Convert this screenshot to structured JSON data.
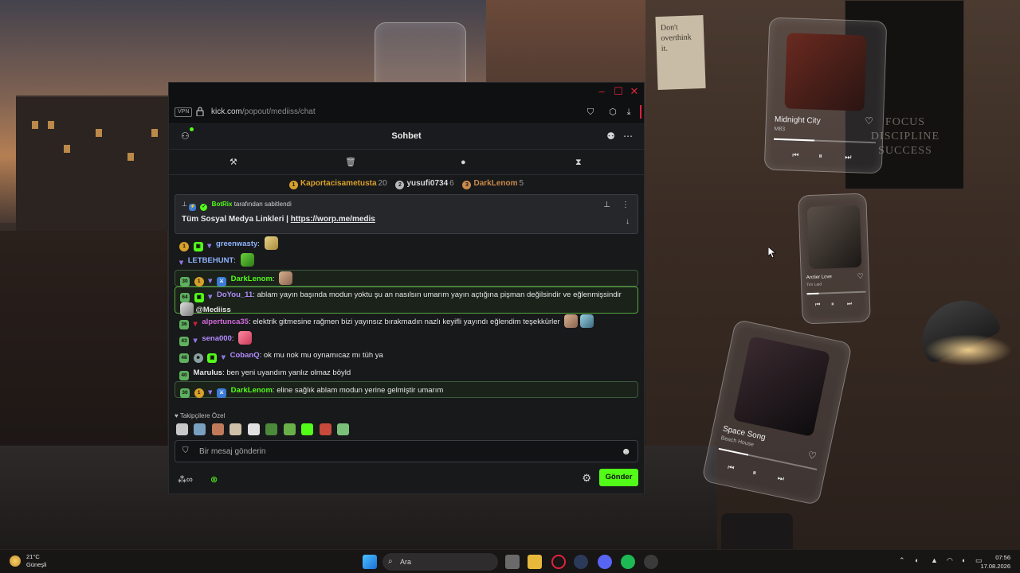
{
  "browser": {
    "vpn_label": "VPN",
    "url_host": "kick.com",
    "url_path": "/popout/mediiss/chat"
  },
  "chat": {
    "title": "Sohbet",
    "top_gifters": [
      {
        "rank": "1",
        "name": "Kaportacisametusta",
        "count": "20",
        "color": "#d8a12a"
      },
      {
        "rank": "2",
        "name": "yusufi0734",
        "count": "6",
        "color": "#b9b9b9"
      },
      {
        "rank": "3",
        "name": "DarkLenom",
        "count": "5",
        "color": "#c98a4a"
      }
    ],
    "pinned": {
      "author": "BotRix",
      "suffix": "tarafından sabitlendi",
      "text": "Tüm Sosyal Medya Linkleri | ",
      "link": "https://worp.me/medis"
    },
    "messages": [
      {
        "badge": "1",
        "user": "greenwasty",
        "color": "#8fb4ff",
        "text": ""
      },
      {
        "badge": "",
        "user": "LETBEHUNT",
        "color": "#8fb4ff",
        "text": ""
      },
      {
        "badge": "30",
        "user": "DarkLenom",
        "color": "#53fc18",
        "text": ""
      },
      {
        "badge": "64",
        "user": "DoYou_11",
        "color": "#b38cff",
        "text": "ablam yayın başında modun yoktu şu an nasılsın umarım yayın açtığına pişman değilsindir ve eğlenmişsindir",
        "text2": "@Mediiss"
      },
      {
        "badge": "36",
        "user": "alpertunca35",
        "color": "#d36bdc",
        "text": "elektrik gitmesine rağmen bizi yayınsız bırakmadın nazlı keyifli yayındı eğlendim teşekkürler"
      },
      {
        "badge": "43",
        "user": "sena000",
        "color": "#b38cff",
        "text": ""
      },
      {
        "badge": "48",
        "user": "CobanQ",
        "color": "#b38cff",
        "text": "ok mu nok mu oynamıcaz mı tüh ya"
      },
      {
        "badge": "40",
        "user": "Marulus",
        "color": "#e6e6e6",
        "text": "ben yeni uyandım yanlız olmaz böyld"
      },
      {
        "badge": "30",
        "user": "DarkLenom",
        "color": "#53fc18",
        "text": "eline sağlık ablam modun yerine gelmiştir umarım"
      }
    ],
    "follower_only_label": "Takipçilere Özel",
    "input_placeholder": "Bir mesaj gönderin",
    "send_label": "Gönder"
  },
  "desktop": {
    "note_text": "Don't overthink it.",
    "poster_text": [
      "FOCUS",
      "DISCIPLINE",
      "SUCCESS"
    ],
    "music_cards": [
      {
        "title": "Midnight City",
        "artist": "M83"
      },
      {
        "title": "Arctier Love",
        "artist": "Tim Laid"
      },
      {
        "title": "Space Song",
        "artist": "Beach House"
      }
    ]
  },
  "taskbar": {
    "weather_temp": "21°C",
    "weather_desc": "Güneşli",
    "search_placeholder": "Ara",
    "time": "07:56",
    "date": "17.08.2026"
  },
  "colors": {
    "accent": "#53fc18",
    "window_bg": "#18191b",
    "close_red": "#e0223c"
  }
}
